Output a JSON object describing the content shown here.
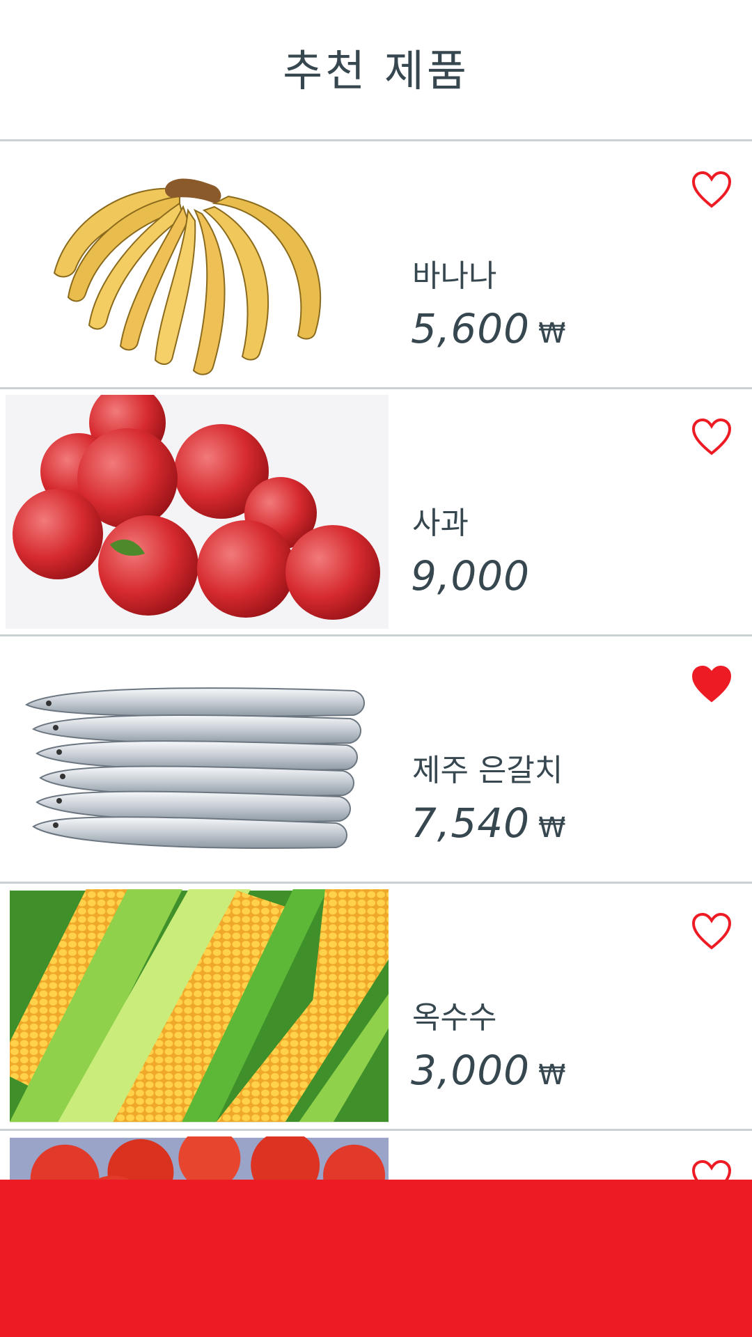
{
  "header": {
    "title": "추천 제품"
  },
  "products": [
    {
      "name": "바나나",
      "price": "5,600",
      "currency": "₩",
      "liked": false,
      "image": "banana"
    },
    {
      "name": "사과",
      "price": "9,000",
      "currency": "",
      "liked": false,
      "image": "apples"
    },
    {
      "name": "제주 은갈치",
      "price": "7,540",
      "currency": "₩",
      "liked": true,
      "image": "hairtail-fish"
    },
    {
      "name": "옥수수",
      "price": "3,000",
      "currency": "₩",
      "liked": false,
      "image": "corn"
    },
    {
      "name": "",
      "price": "",
      "currency": "",
      "liked": false,
      "image": "tomatoes"
    }
  ],
  "colors": {
    "accent": "#ed1c24",
    "text": "#37474f",
    "divider": "#c9d1d3"
  }
}
